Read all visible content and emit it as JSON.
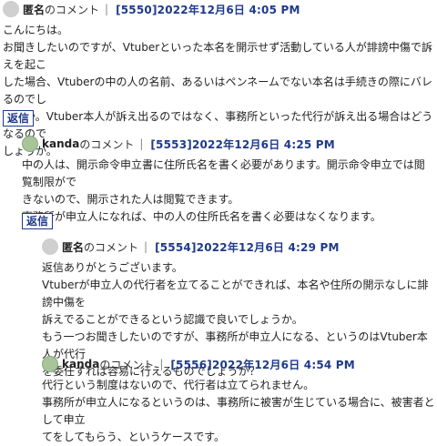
{
  "comments": [
    {
      "author": "匿名",
      "suffix": "のコメント",
      "sep": "|",
      "stamp": "[5550]2022年12月6日 4:05 PM",
      "lines": [
        "こんにちは。",
        "お聞きしたいのですが、Vtuberといった本名を開示せず活動している人が誹謗中傷で訴えを起こ",
        "した場合、Vtuberの中の人の名前、あるいはペンネームでない本名は手続きの際にバレるのでし",
        "ょうか。Vtuber本人が訴え出るのではなく、事務所といった代行が訴え出る場合はどうなるので",
        "しょうか。"
      ],
      "reply_label": "返信"
    },
    {
      "author": "kanda",
      "suffix": "のコメント",
      "sep": "|",
      "stamp": "[5553]2022年12月6日 4:25 PM",
      "lines": [
        "中の人は、開示命令申立書に住所氏名を書く必要があります。開示命令申立では閲覧制限がで",
        "きないので、開示された人は閲覧できます。",
        "事務所が申立人になれば、中の人の住所氏名を書く必要はなくなります。"
      ],
      "reply_label": "返信"
    },
    {
      "author": "匿名",
      "suffix": "のコメント",
      "sep": "|",
      "stamp": "[5554]2022年12月6日 4:29 PM",
      "lines": [
        "返信ありがとうございます。",
        "Vtuberが申立人の代行者を立てることができれば、本名や住所の開示なしに誹謗中傷を",
        "訴えでることができるという認識で良いでしょうか。",
        "もう一つお聞きしたいのですが、事務所が申立人になる、というのはVtuber本人が代行",
        "を委任すれば容易に行えるものでしょうか？"
      ]
    },
    {
      "author": "kanda",
      "suffix": "のコメント",
      "sep": "|",
      "stamp": "[5556]2022年12月6日 4:54 PM",
      "lines": [
        "代行という制度はないので、代行者は立てられません。",
        "事務所が申立人になるというのは、事務所に被害が生じている場合に、被害者として申立",
        "てをしてもらう、というケースです。"
      ]
    }
  ]
}
